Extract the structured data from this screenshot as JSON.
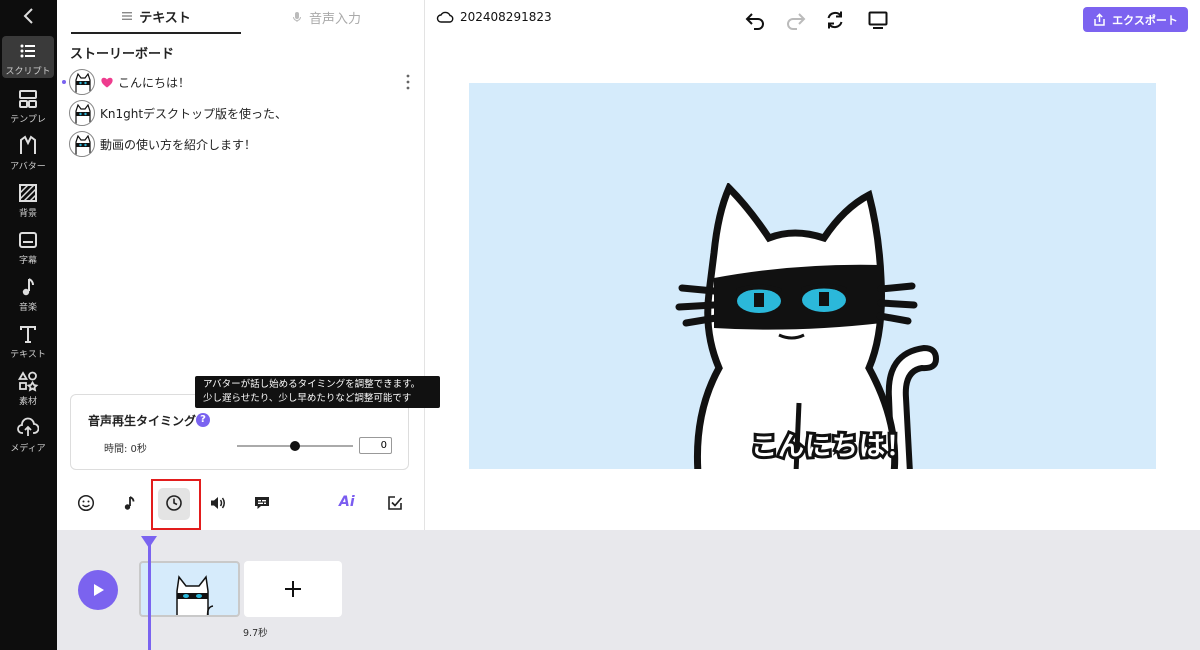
{
  "sidebar": {
    "items": [
      {
        "label": "スクリプト",
        "icon": "list-icon",
        "active": true
      },
      {
        "label": "テンプレ",
        "icon": "template-icon"
      },
      {
        "label": "アバター",
        "icon": "avatar-icon"
      },
      {
        "label": "背景",
        "icon": "background-icon"
      },
      {
        "label": "字幕",
        "icon": "subtitle-icon"
      },
      {
        "label": "音楽",
        "icon": "music-icon"
      },
      {
        "label": "テキスト",
        "icon": "text-icon"
      },
      {
        "label": "素材",
        "icon": "assets-icon"
      },
      {
        "label": "メディア",
        "icon": "upload-icon"
      }
    ]
  },
  "panel": {
    "tabs": [
      {
        "label": "テキスト",
        "icon": "lines-icon",
        "active": true
      },
      {
        "label": "音声入力",
        "icon": "microphone-icon",
        "active": false
      }
    ],
    "storyboard_title": "ストーリーボード",
    "scenes": [
      {
        "text": "こんにちは！",
        "has_heart": true
      },
      {
        "text": "Kn1ghtデスクトップ版を使った、",
        "has_heart": false
      },
      {
        "text": "動画の使い方を紹介します！",
        "has_heart": false
      }
    ],
    "tooltip": {
      "line1": "アバターが話し始めるタイミングを調整できます。",
      "line2": "少し遅らせたり、少し早めたりなど調整可能です"
    },
    "timing": {
      "title": "音声再生タイミング",
      "help": "?",
      "time_label": "時間: 0秒",
      "value": "0",
      "slider_fraction": 0.5
    },
    "toolbar": {
      "ai_label": "Ai"
    }
  },
  "header": {
    "project_name": "202408291823",
    "export_label": "エクスポート"
  },
  "preview": {
    "caption": "こんにちは！",
    "background_color": "#d5ebfb"
  },
  "timeline": {
    "clip_duration": "9.7秒"
  },
  "colors": {
    "accent": "#7a63f0",
    "highlight": "#e21d1d"
  }
}
